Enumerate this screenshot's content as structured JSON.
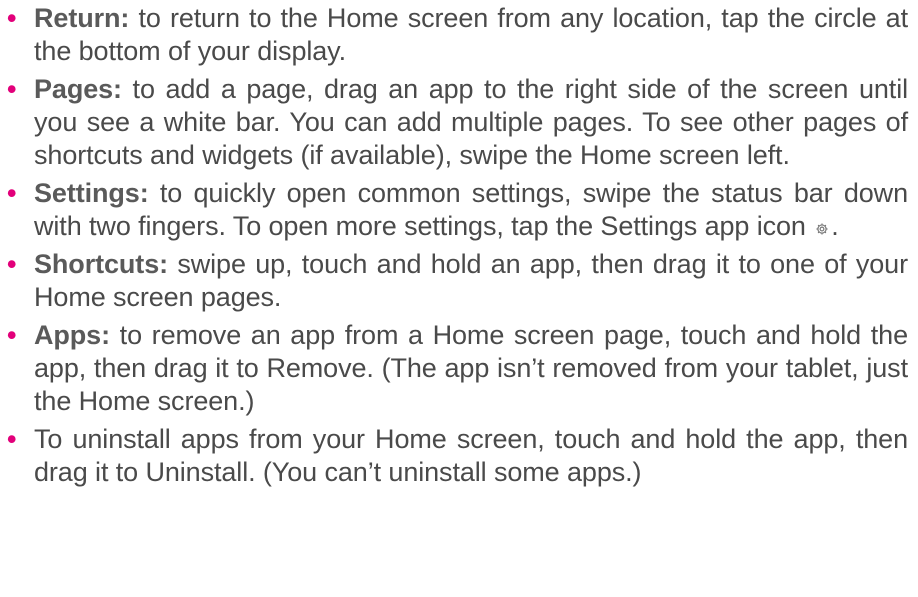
{
  "bullet_color": "#e2007a",
  "items": [
    {
      "term": "Return:",
      "text": " to return to the Home screen from any location, tap the circle at the bottom of your display."
    },
    {
      "term": "Pages:",
      "text": " to add a page, drag an app to the right side of the screen until you see a white bar. You can add multiple pages. To see other pages of shortcuts and widgets (if available), swipe the Home screen left."
    },
    {
      "term": "Settings:",
      "text": " to quickly open common settings, swipe the status bar down with two fingers. To open more settings, tap the Settings app icon",
      "icon": "gear-icon",
      "text_after": "."
    },
    {
      "term": "Shortcuts:",
      "text": " swipe up, touch and hold an app, then drag it to one of your Home screen pages."
    },
    {
      "term": "Apps:",
      "text": " to remove an app from a Home screen page, touch and hold the app, then drag it to Remove. (The app isn’t removed from your tablet, just the Home screen.)"
    },
    {
      "term": "",
      "text": "To uninstall apps from your Home screen, touch and hold the app, then drag it to Uninstall. (You can’t uninstall some apps.)"
    }
  ]
}
